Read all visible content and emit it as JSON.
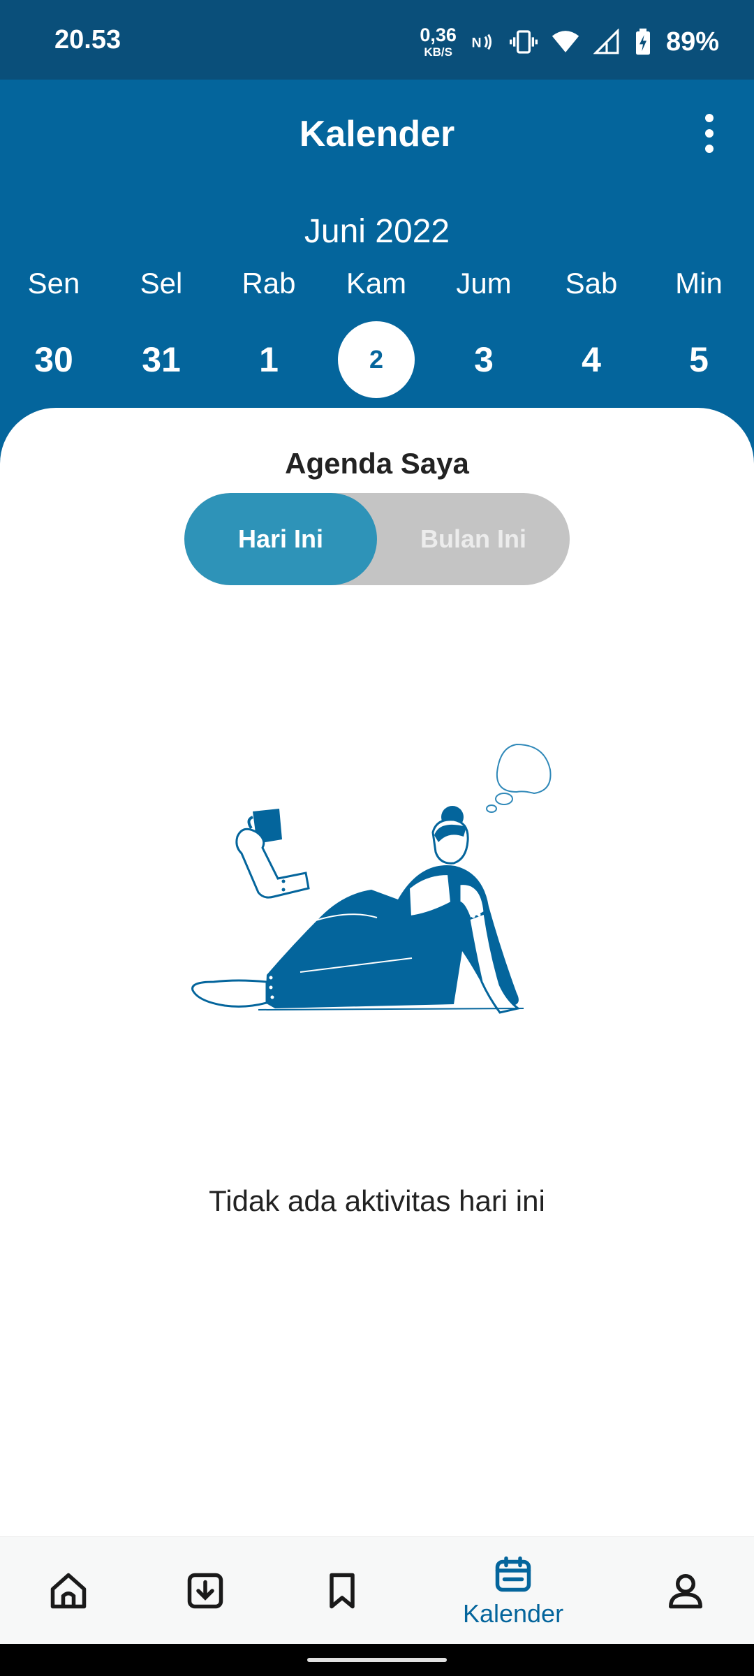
{
  "status_bar": {
    "time": "20.53",
    "net_speed_value": "0,36",
    "net_speed_unit": "KB/S",
    "battery": "89%",
    "icons": [
      "nfc-icon",
      "vibrate-icon",
      "wifi-icon",
      "signal-icon",
      "battery-charging-icon"
    ]
  },
  "header": {
    "title": "Kalender",
    "menu_icon": "more-vert-icon",
    "month": "Juni 2022"
  },
  "week": [
    {
      "name": "Sen",
      "date": "30",
      "selected": false
    },
    {
      "name": "Sel",
      "date": "31",
      "selected": false
    },
    {
      "name": "Rab",
      "date": "1",
      "selected": false
    },
    {
      "name": "Kam",
      "date": "2",
      "selected": true
    },
    {
      "name": "Jum",
      "date": "3",
      "selected": false
    },
    {
      "name": "Sab",
      "date": "4",
      "selected": false
    },
    {
      "name": "Min",
      "date": "5",
      "selected": false
    }
  ],
  "agenda": {
    "title": "Agenda Saya",
    "toggle": {
      "today": "Hari Ini",
      "month": "Bulan Ini",
      "selected": "Hari Ini"
    },
    "empty_message": "Tidak ada aktivitas hari ini"
  },
  "bottom_nav": {
    "items": [
      {
        "icon": "home-icon",
        "label": ""
      },
      {
        "icon": "download-icon",
        "label": ""
      },
      {
        "icon": "bookmark-icon",
        "label": ""
      },
      {
        "icon": "calendar-icon",
        "label": "Kalender",
        "active": true
      },
      {
        "icon": "profile-icon",
        "label": ""
      }
    ]
  },
  "colors": {
    "status_bar": "#0a4f7a",
    "header": "#04659c",
    "toggle_active": "#2e93b8",
    "toggle_inactive": "#c4c4c4"
  }
}
